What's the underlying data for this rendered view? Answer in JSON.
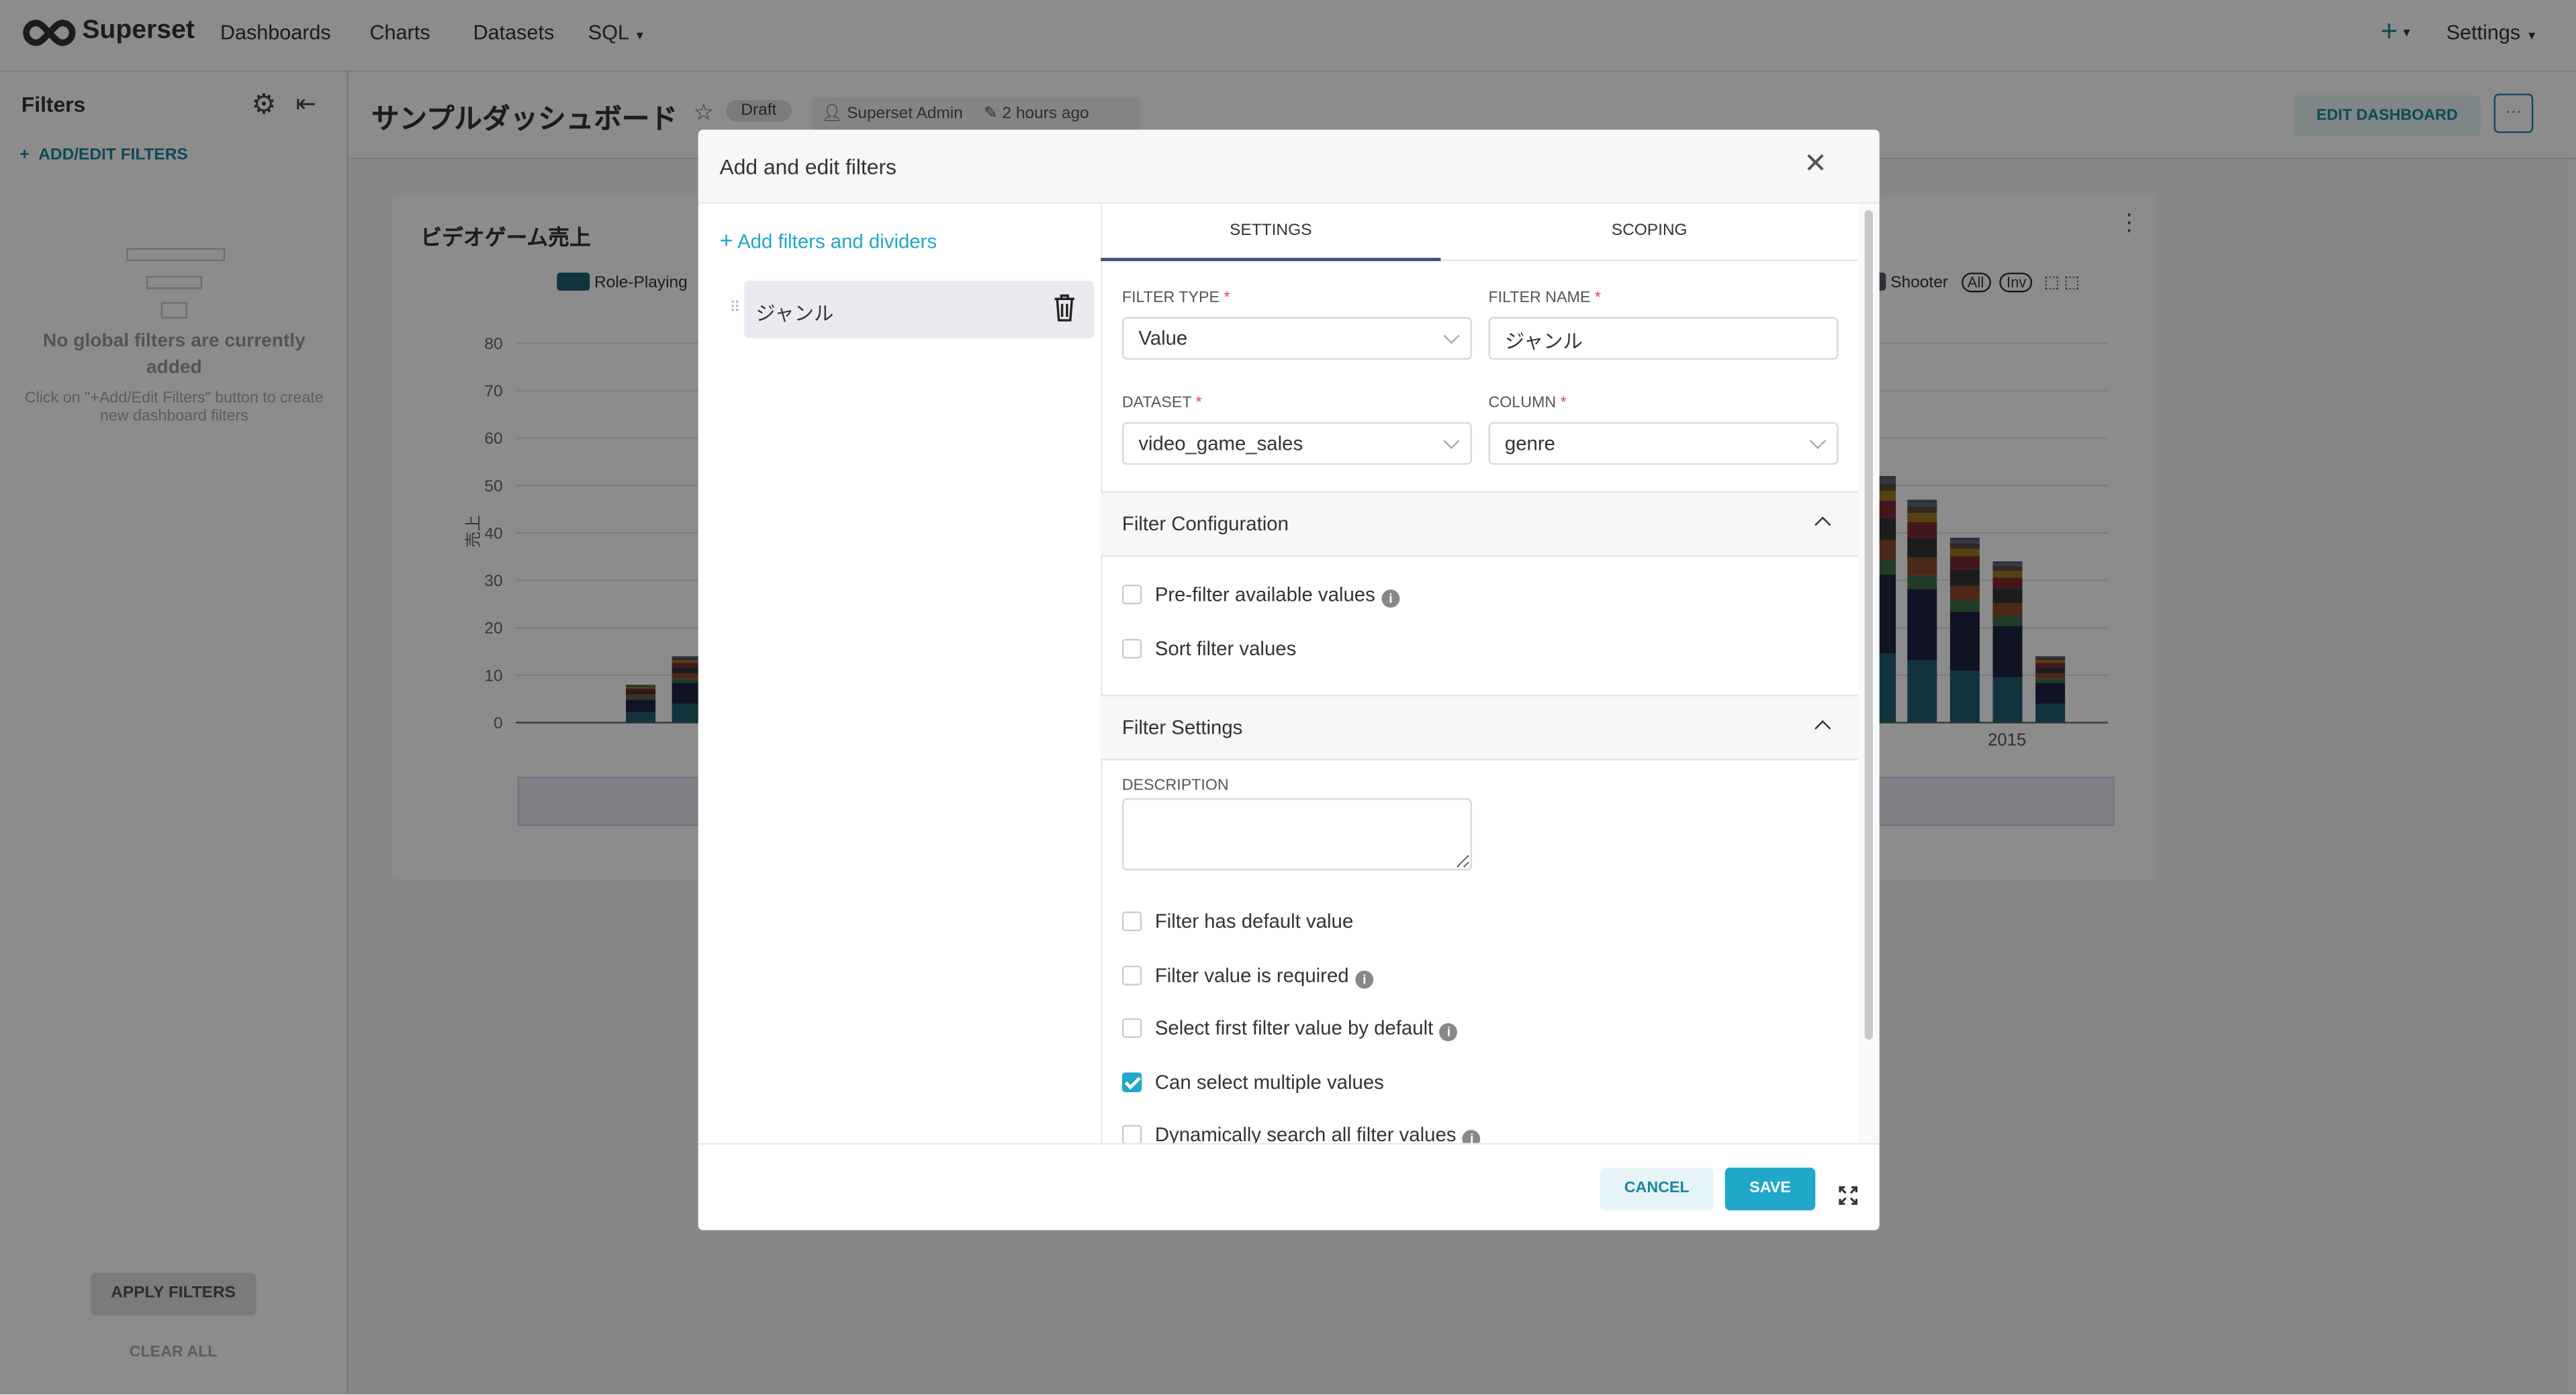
{
  "nav": {
    "brand": "Superset",
    "items": [
      "Dashboards",
      "Charts",
      "Datasets",
      "SQL"
    ],
    "plus": "+",
    "settings": "Settings"
  },
  "sidebar": {
    "title": "Filters",
    "add_edit": "ADD/EDIT FILTERS",
    "empty_title": "No global filters are currently added",
    "empty_hint": "Click on \"+Add/Edit Filters\" button to create new dashboard filters",
    "apply": "APPLY FILTERS",
    "clear": "CLEAR ALL"
  },
  "dashboard": {
    "title": "サンプルダッシュボード",
    "status": "Draft",
    "owner": "Superset Admin",
    "modified": "2 hours ago",
    "edit_button": "EDIT DASHBOARD",
    "more": "···"
  },
  "chart": {
    "title": "ビデオゲーム売上",
    "legend": [
      "Role-Playing",
      "Shooter"
    ],
    "legend_all": "All",
    "legend_inv": "Inv",
    "ylabel": "売上",
    "x_tick": "2015"
  },
  "chart_data": {
    "type": "bar",
    "stacked": true,
    "ylabel": "売上",
    "ylim": [
      0,
      80
    ],
    "yticks": [
      0,
      10,
      20,
      30,
      40,
      50,
      60,
      70,
      80
    ],
    "visible_bar_totals": [
      8,
      14,
      52,
      47,
      39,
      34,
      14
    ],
    "x_tick_labels": [
      "2015"
    ],
    "colors": [
      "#1f5f6e",
      "#1e2440",
      "#3a6e4a",
      "#8a4a2e",
      "#333333",
      "#7a2a2e",
      "#9a7a20",
      "#5a4a40",
      "#5a6a7a",
      "#555a6a"
    ]
  },
  "modal": {
    "title": "Add and edit filters",
    "add_link": "Add filters and dividers",
    "filter_item": "ジャンル",
    "tabs": [
      "SETTINGS",
      "SCOPING"
    ],
    "filter_type_label": "FILTER TYPE",
    "filter_type": "Value",
    "filter_name_label": "FILTER NAME",
    "filter_name": "ジャンル",
    "dataset_label": "DATASET",
    "dataset": "video_game_sales",
    "column_label": "COLUMN",
    "column": "genre",
    "config_section": "Filter Configuration",
    "config_options": [
      {
        "label": "Pre-filter available values",
        "checked": false,
        "info": true
      },
      {
        "label": "Sort filter values",
        "checked": false,
        "info": false
      }
    ],
    "settings_section": "Filter Settings",
    "description_label": "DESCRIPTION",
    "description": "",
    "settings_options": [
      {
        "label": "Filter has default value",
        "checked": false,
        "info": false
      },
      {
        "label": "Filter value is required",
        "checked": false,
        "info": true
      },
      {
        "label": "Select first filter value by default",
        "checked": false,
        "info": true
      },
      {
        "label": "Can select multiple values",
        "checked": true,
        "info": false
      },
      {
        "label": "Dynamically search all filter values",
        "checked": false,
        "info": true
      }
    ],
    "cancel": "CANCEL",
    "save": "SAVE"
  },
  "colors": {
    "accent": "#20a7c9",
    "primary_dark": "#1a85a0",
    "tab_underline": "#484e7a"
  }
}
